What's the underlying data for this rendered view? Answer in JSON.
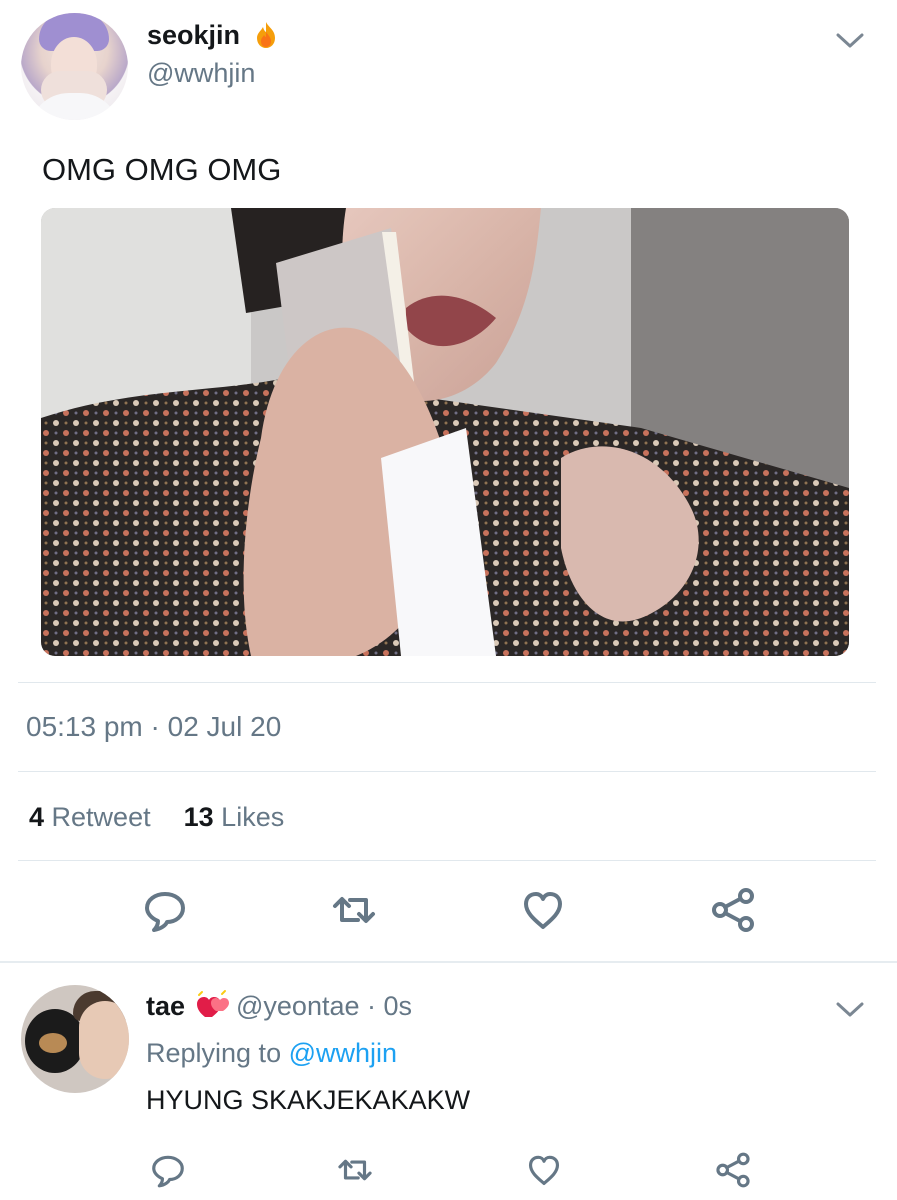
{
  "tweet": {
    "author_name": "seokjin",
    "author_handle": "@wwhjin",
    "text": "OMG OMG OMG",
    "timestamp": "05:13 pm · 02 Jul 20",
    "retweet_count": "4",
    "retweet_label": " Retweet",
    "likes_count": "13",
    "likes_label": " Likes",
    "icons": {
      "name_emoji": "fire-icon",
      "menu": "chevron-down-icon",
      "reply": "reply-icon",
      "retweet": "retweet-icon",
      "like": "heart-icon",
      "share": "share-icon"
    }
  },
  "reply": {
    "author_name": "tae",
    "author_handle_time": "@yeontae · 0s",
    "replying_prefix": "Replying to ",
    "replying_to": "@wwhjin",
    "text": "HYUNG SKAKJEKAKAKW",
    "icons": {
      "name_emoji": "two-hearts-icon",
      "menu": "chevron-down-icon",
      "reply": "reply-icon",
      "retweet": "retweet-icon",
      "like": "heart-icon",
      "share": "share-icon"
    }
  },
  "colors": {
    "text": "#14171a",
    "secondary": "#657786",
    "accent": "#1da1f2",
    "divider": "#e1e8ed",
    "icon": "#657786"
  }
}
